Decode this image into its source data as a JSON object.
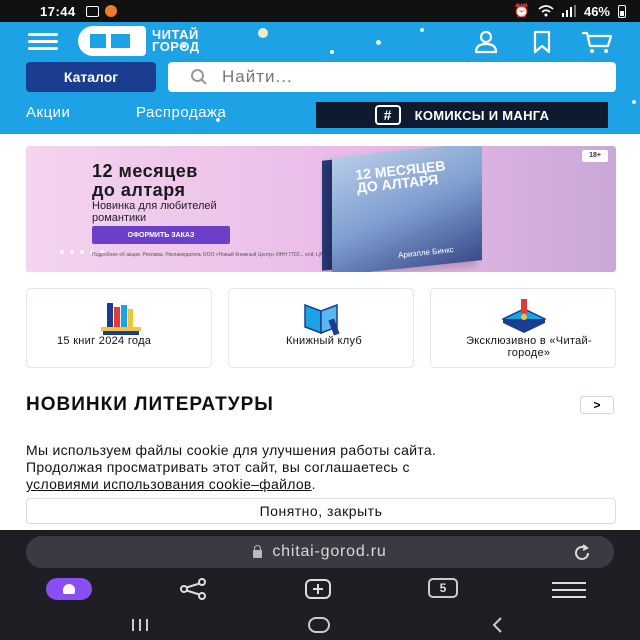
{
  "status": {
    "time": "17:44",
    "battery": "46%"
  },
  "header": {
    "logo_text_line1": "ЧИТАЙ",
    "logo_text_line2": "ГОРОД",
    "catalog_label": "Каталог",
    "search_placeholder": "Найти...",
    "nav": {
      "promos": "Акции",
      "sale": "Распродажа",
      "comics": "КОМИКСЫ И МАНГА",
      "comics_icon_text": "#"
    }
  },
  "banner": {
    "title_line1": "12 месяцев",
    "title_line2": "до алтаря",
    "subtitle_line1": "Новинка для любителей",
    "subtitle_line2": "романтики",
    "cta": "ОФОРМИТЬ ЗАКАЗ",
    "legal": "Подробнее об акции. Реклама. Рекламодатель ООО «Новый Книжный Центр» ИНН 7702... erid: LjN8Kx...",
    "book_title_line1": "12 МЕСЯЦЕВ",
    "book_title_line2": "ДО АЛТАРЯ",
    "book_author": "Ариэлле Бинкс",
    "age": "18+"
  },
  "features": [
    {
      "label": "15 книг 2024 года",
      "icon": "books-stack-icon"
    },
    {
      "label": "Книжный клуб",
      "icon": "open-book-icon"
    },
    {
      "label": "Эксклюзивно в «Читай-городе»",
      "icon": "exclusive-book-icon"
    }
  ],
  "new_books": {
    "title": "НОВИНКИ ЛИТЕРАТУРЫ",
    "arrow": ">"
  },
  "cookie": {
    "text_line1": "Мы используем файлы cookie для улучшения работы сайта.",
    "text_line2": "Продолжая просматривать этот сайт, вы соглашаетесь с",
    "link": "условиями использования cookie–файлов",
    "period": ".",
    "button": "Понятно, закрыть"
  },
  "browser": {
    "url": "chitai-gorod.ru",
    "tabs_count": "5"
  },
  "colors": {
    "brand_blue": "#1ea2e6",
    "catalog_navy": "#1b3d8f",
    "comics_dark": "#0e1a2e",
    "cta_purple": "#6b3fc8",
    "alice_purple": "#8a4ff4"
  }
}
